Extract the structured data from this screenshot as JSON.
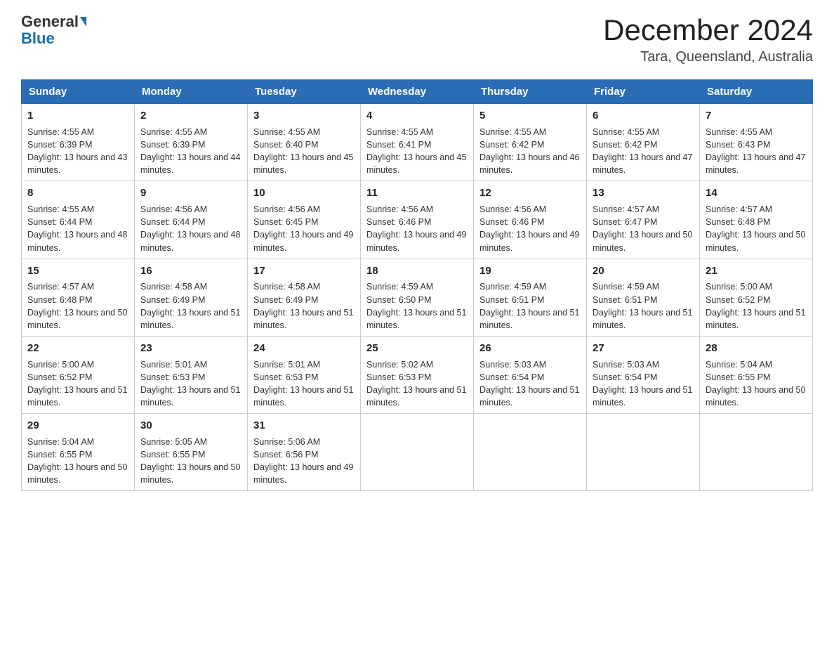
{
  "header": {
    "logo_general": "General",
    "logo_blue": "Blue",
    "month_title": "December 2024",
    "location": "Tara, Queensland, Australia"
  },
  "days_of_week": [
    "Sunday",
    "Monday",
    "Tuesday",
    "Wednesday",
    "Thursday",
    "Friday",
    "Saturday"
  ],
  "weeks": [
    [
      {
        "day": "1",
        "sunrise": "4:55 AM",
        "sunset": "6:39 PM",
        "daylight": "13 hours and 43 minutes."
      },
      {
        "day": "2",
        "sunrise": "4:55 AM",
        "sunset": "6:39 PM",
        "daylight": "13 hours and 44 minutes."
      },
      {
        "day": "3",
        "sunrise": "4:55 AM",
        "sunset": "6:40 PM",
        "daylight": "13 hours and 45 minutes."
      },
      {
        "day": "4",
        "sunrise": "4:55 AM",
        "sunset": "6:41 PM",
        "daylight": "13 hours and 45 minutes."
      },
      {
        "day": "5",
        "sunrise": "4:55 AM",
        "sunset": "6:42 PM",
        "daylight": "13 hours and 46 minutes."
      },
      {
        "day": "6",
        "sunrise": "4:55 AM",
        "sunset": "6:42 PM",
        "daylight": "13 hours and 47 minutes."
      },
      {
        "day": "7",
        "sunrise": "4:55 AM",
        "sunset": "6:43 PM",
        "daylight": "13 hours and 47 minutes."
      }
    ],
    [
      {
        "day": "8",
        "sunrise": "4:55 AM",
        "sunset": "6:44 PM",
        "daylight": "13 hours and 48 minutes."
      },
      {
        "day": "9",
        "sunrise": "4:56 AM",
        "sunset": "6:44 PM",
        "daylight": "13 hours and 48 minutes."
      },
      {
        "day": "10",
        "sunrise": "4:56 AM",
        "sunset": "6:45 PM",
        "daylight": "13 hours and 49 minutes."
      },
      {
        "day": "11",
        "sunrise": "4:56 AM",
        "sunset": "6:46 PM",
        "daylight": "13 hours and 49 minutes."
      },
      {
        "day": "12",
        "sunrise": "4:56 AM",
        "sunset": "6:46 PM",
        "daylight": "13 hours and 49 minutes."
      },
      {
        "day": "13",
        "sunrise": "4:57 AM",
        "sunset": "6:47 PM",
        "daylight": "13 hours and 50 minutes."
      },
      {
        "day": "14",
        "sunrise": "4:57 AM",
        "sunset": "6:48 PM",
        "daylight": "13 hours and 50 minutes."
      }
    ],
    [
      {
        "day": "15",
        "sunrise": "4:57 AM",
        "sunset": "6:48 PM",
        "daylight": "13 hours and 50 minutes."
      },
      {
        "day": "16",
        "sunrise": "4:58 AM",
        "sunset": "6:49 PM",
        "daylight": "13 hours and 51 minutes."
      },
      {
        "day": "17",
        "sunrise": "4:58 AM",
        "sunset": "6:49 PM",
        "daylight": "13 hours and 51 minutes."
      },
      {
        "day": "18",
        "sunrise": "4:59 AM",
        "sunset": "6:50 PM",
        "daylight": "13 hours and 51 minutes."
      },
      {
        "day": "19",
        "sunrise": "4:59 AM",
        "sunset": "6:51 PM",
        "daylight": "13 hours and 51 minutes."
      },
      {
        "day": "20",
        "sunrise": "4:59 AM",
        "sunset": "6:51 PM",
        "daylight": "13 hours and 51 minutes."
      },
      {
        "day": "21",
        "sunrise": "5:00 AM",
        "sunset": "6:52 PM",
        "daylight": "13 hours and 51 minutes."
      }
    ],
    [
      {
        "day": "22",
        "sunrise": "5:00 AM",
        "sunset": "6:52 PM",
        "daylight": "13 hours and 51 minutes."
      },
      {
        "day": "23",
        "sunrise": "5:01 AM",
        "sunset": "6:53 PM",
        "daylight": "13 hours and 51 minutes."
      },
      {
        "day": "24",
        "sunrise": "5:01 AM",
        "sunset": "6:53 PM",
        "daylight": "13 hours and 51 minutes."
      },
      {
        "day": "25",
        "sunrise": "5:02 AM",
        "sunset": "6:53 PM",
        "daylight": "13 hours and 51 minutes."
      },
      {
        "day": "26",
        "sunrise": "5:03 AM",
        "sunset": "6:54 PM",
        "daylight": "13 hours and 51 minutes."
      },
      {
        "day": "27",
        "sunrise": "5:03 AM",
        "sunset": "6:54 PM",
        "daylight": "13 hours and 51 minutes."
      },
      {
        "day": "28",
        "sunrise": "5:04 AM",
        "sunset": "6:55 PM",
        "daylight": "13 hours and 50 minutes."
      }
    ],
    [
      {
        "day": "29",
        "sunrise": "5:04 AM",
        "sunset": "6:55 PM",
        "daylight": "13 hours and 50 minutes."
      },
      {
        "day": "30",
        "sunrise": "5:05 AM",
        "sunset": "6:55 PM",
        "daylight": "13 hours and 50 minutes."
      },
      {
        "day": "31",
        "sunrise": "5:06 AM",
        "sunset": "6:56 PM",
        "daylight": "13 hours and 49 minutes."
      },
      null,
      null,
      null,
      null
    ]
  ]
}
